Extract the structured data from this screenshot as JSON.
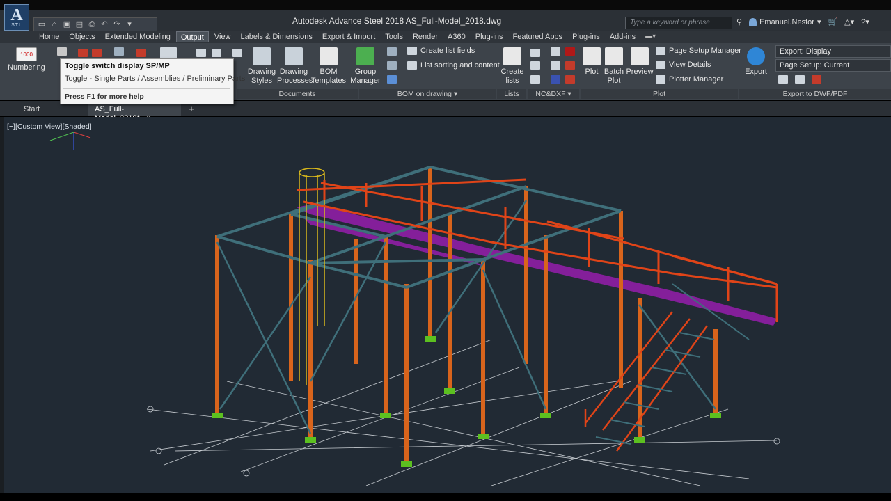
{
  "app": {
    "logo_letter": "A",
    "logo_sub": "STL",
    "title": "Autodesk Advance Steel 2018    AS_Full-Model_2018.dwg",
    "search_placeholder": "Type a keyword or phrase",
    "user": "Emanuel.Nestor"
  },
  "ribbon_tabs": [
    {
      "label": "Home"
    },
    {
      "label": "Objects"
    },
    {
      "label": "Extended Modeling"
    },
    {
      "label": "Output",
      "active": true
    },
    {
      "label": "View"
    },
    {
      "label": "Labels & Dimensions"
    },
    {
      "label": "Export & Import"
    },
    {
      "label": "Tools"
    },
    {
      "label": "Render"
    },
    {
      "label": "A360"
    },
    {
      "label": "Plug-ins"
    },
    {
      "label": "Featured Apps"
    },
    {
      "label": "Plug-ins"
    },
    {
      "label": "Add-ins"
    }
  ],
  "ribbon": {
    "numbering": "Numbering",
    "numbering_icon_text": "1000",
    "drawing_styles": "Drawing\nStyles",
    "drawing_processes": "Drawing\nProcesses",
    "bom_templates": "BOM\nTemplates",
    "group_manager": "Group\nManager",
    "create_list_fields": "Create list fields",
    "list_sorting": "List sorting and content",
    "create_lists": "Create\nlists",
    "plot": "Plot",
    "batch_plot": "Batch\nPlot",
    "preview": "Preview",
    "page_setup_manager": "Page Setup Manager",
    "view_details": "View Details",
    "plotter_manager": "Plotter Manager",
    "export": "Export",
    "export_display": "Export: Display",
    "page_setup_current": "Page Setup: Current",
    "panels": {
      "documents": "Documents",
      "bom_on_drawing": "BOM on drawing",
      "lists": "Lists",
      "ncdxf": "NC&DXF",
      "plot": "Plot",
      "export_dwf": "Export to DWF/PDF"
    }
  },
  "tooltip": {
    "title": "Toggle switch display SP/MP",
    "description": "Toggle - Single Parts / Assemblies / Preliminary Parts",
    "help": "Press F1 for more help"
  },
  "file_tabs": [
    {
      "label": "Start"
    },
    {
      "label": "AS_Full-Model_2018*",
      "active": true
    }
  ],
  "viewport": {
    "label": "[−][Custom View][Shaded]"
  },
  "colors": {
    "viewport_bg": "#212a34",
    "column": "#d8641c",
    "beam": "#3f6f7a",
    "grating": "#8a1fa0",
    "railing": "#e04418",
    "ladder": "#d8b81c"
  }
}
